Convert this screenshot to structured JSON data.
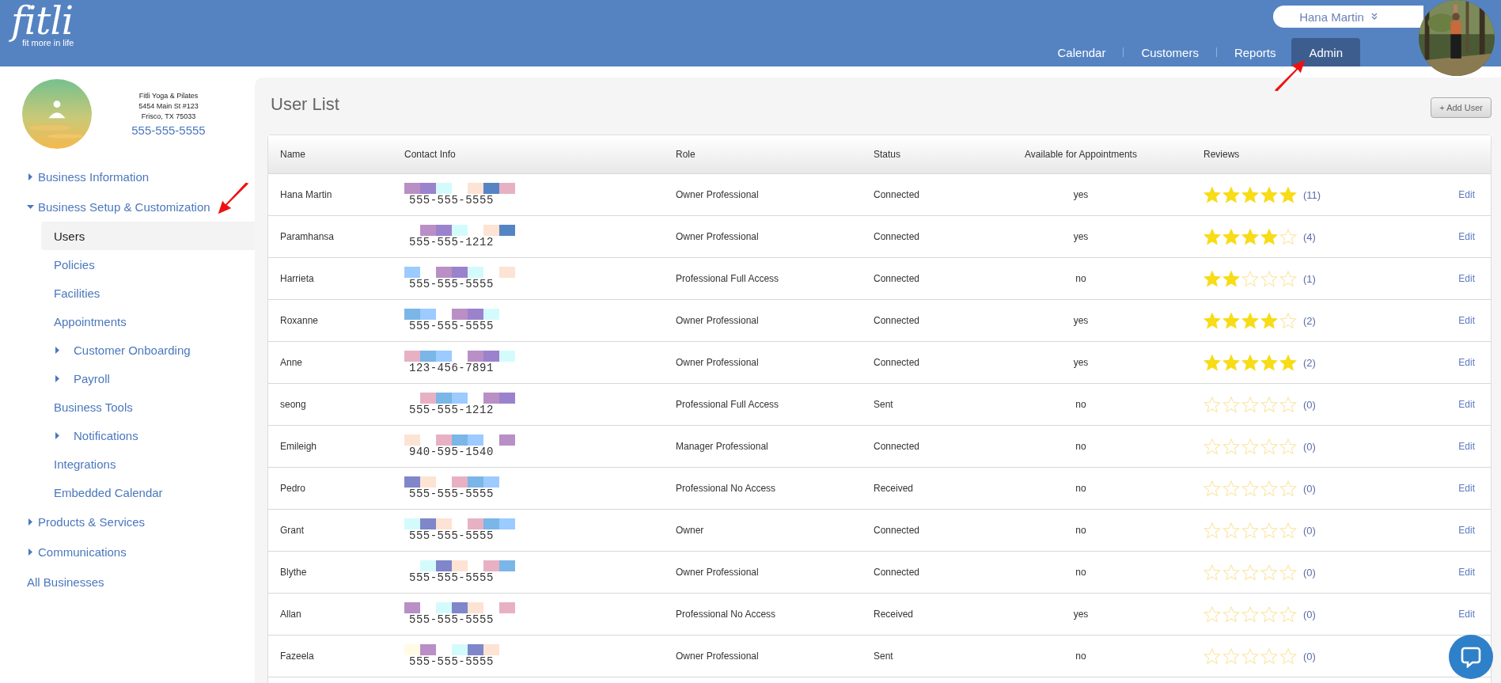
{
  "header": {
    "logo": "fitli",
    "tagline": "fit more in life",
    "user_menu": "Hana Martin",
    "nav": [
      {
        "label": "Calendar",
        "selected": false
      },
      {
        "label": "Customers",
        "selected": false
      },
      {
        "label": "Reports",
        "selected": false
      },
      {
        "label": "Admin",
        "selected": true
      }
    ]
  },
  "sidebar": {
    "business": {
      "name": "Fitli Yoga & Pilates",
      "address": [
        "5454 Main St #123",
        "Frisco, TX 75033"
      ],
      "phone": "555-555-5555"
    },
    "items": [
      {
        "label": "Business Information",
        "kind": "group",
        "expanded": false,
        "selected": false
      },
      {
        "label": "Business Setup & Customization",
        "kind": "group",
        "expanded": true,
        "selected": false,
        "children": [
          {
            "label": "Users",
            "kind": "link",
            "selected": true
          },
          {
            "label": "Policies",
            "kind": "link",
            "selected": false
          },
          {
            "label": "Facilities",
            "kind": "link",
            "selected": false
          },
          {
            "label": "Appointments",
            "kind": "link",
            "selected": false
          },
          {
            "label": "Customer Onboarding",
            "kind": "group",
            "expanded": false,
            "selected": false
          },
          {
            "label": "Payroll",
            "kind": "group",
            "expanded": false,
            "selected": false
          },
          {
            "label": "Business Tools",
            "kind": "link",
            "selected": false
          },
          {
            "label": "Notifications",
            "kind": "group",
            "expanded": false,
            "selected": false
          },
          {
            "label": "Integrations",
            "kind": "link",
            "selected": false
          },
          {
            "label": "Embedded Calendar",
            "kind": "link",
            "selected": false
          }
        ]
      },
      {
        "label": "Products & Services",
        "kind": "group",
        "expanded": false,
        "selected": false
      },
      {
        "label": "Communications",
        "kind": "group",
        "expanded": false,
        "selected": false
      },
      {
        "label": "All Businesses",
        "kind": "link",
        "selected": false
      }
    ]
  },
  "page": {
    "title": "User List",
    "add_button": "+ Add User"
  },
  "table": {
    "columns": [
      "Name",
      "Contact Info",
      "Role",
      "Status",
      "Available for Appointments",
      "Reviews"
    ],
    "rows": [
      {
        "name": "Hana Martin",
        "phone": "555-555-5555",
        "role": "Owner Professional",
        "status": "Connected",
        "available": "yes",
        "stars": 5,
        "reviews": "(11)",
        "edit": "Edit"
      },
      {
        "name": "Paramhansa",
        "phone": "555-555-1212",
        "role": "Owner Professional",
        "status": "Connected",
        "available": "yes",
        "stars": 4,
        "reviews": "(4)",
        "edit": "Edit"
      },
      {
        "name": "Harrieta",
        "phone": "555-555-5555",
        "role": "Professional Full Access",
        "status": "Connected",
        "available": "no",
        "stars": 2,
        "reviews": "(1)",
        "edit": "Edit"
      },
      {
        "name": "Roxanne",
        "phone": "555-555-5555",
        "role": "Owner Professional",
        "status": "Connected",
        "available": "yes",
        "stars": 4,
        "reviews": "(2)",
        "edit": "Edit"
      },
      {
        "name": "Anne",
        "phone": "123-456-7891",
        "role": "Owner Professional",
        "status": "Connected",
        "available": "yes",
        "stars": 5,
        "reviews": "(2)",
        "edit": "Edit"
      },
      {
        "name": "seong",
        "phone": "555-555-1212",
        "role": "Professional Full Access",
        "status": "Sent",
        "available": "no",
        "stars": 0,
        "reviews": "(0)",
        "edit": "Edit"
      },
      {
        "name": "Emileigh",
        "phone": "940-595-1540",
        "role": "Manager Professional",
        "status": "Connected",
        "available": "no",
        "stars": 0,
        "reviews": "(0)",
        "edit": "Edit"
      },
      {
        "name": "Pedro",
        "phone": "555-555-5555",
        "role": "Professional No Access",
        "status": "Received",
        "available": "no",
        "stars": 0,
        "reviews": "(0)",
        "edit": "Edit"
      },
      {
        "name": "Grant",
        "phone": "555-555-5555",
        "role": "Owner",
        "status": "Connected",
        "available": "no",
        "stars": 0,
        "reviews": "(0)",
        "edit": "Edit"
      },
      {
        "name": "Blythe",
        "phone": "555-555-5555",
        "role": "Owner Professional",
        "status": "Connected",
        "available": "no",
        "stars": 0,
        "reviews": "(0)",
        "edit": "Edit"
      },
      {
        "name": "Allan",
        "phone": "555-555-5555",
        "role": "Professional No Access",
        "status": "Received",
        "available": "yes",
        "stars": 0,
        "reviews": "(0)",
        "edit": "Edit"
      },
      {
        "name": "Fazeela",
        "phone": "555-555-5555",
        "role": "Owner Professional",
        "status": "Sent",
        "available": "no",
        "stars": 0,
        "reviews": "(0)"
      }
    ]
  }
}
